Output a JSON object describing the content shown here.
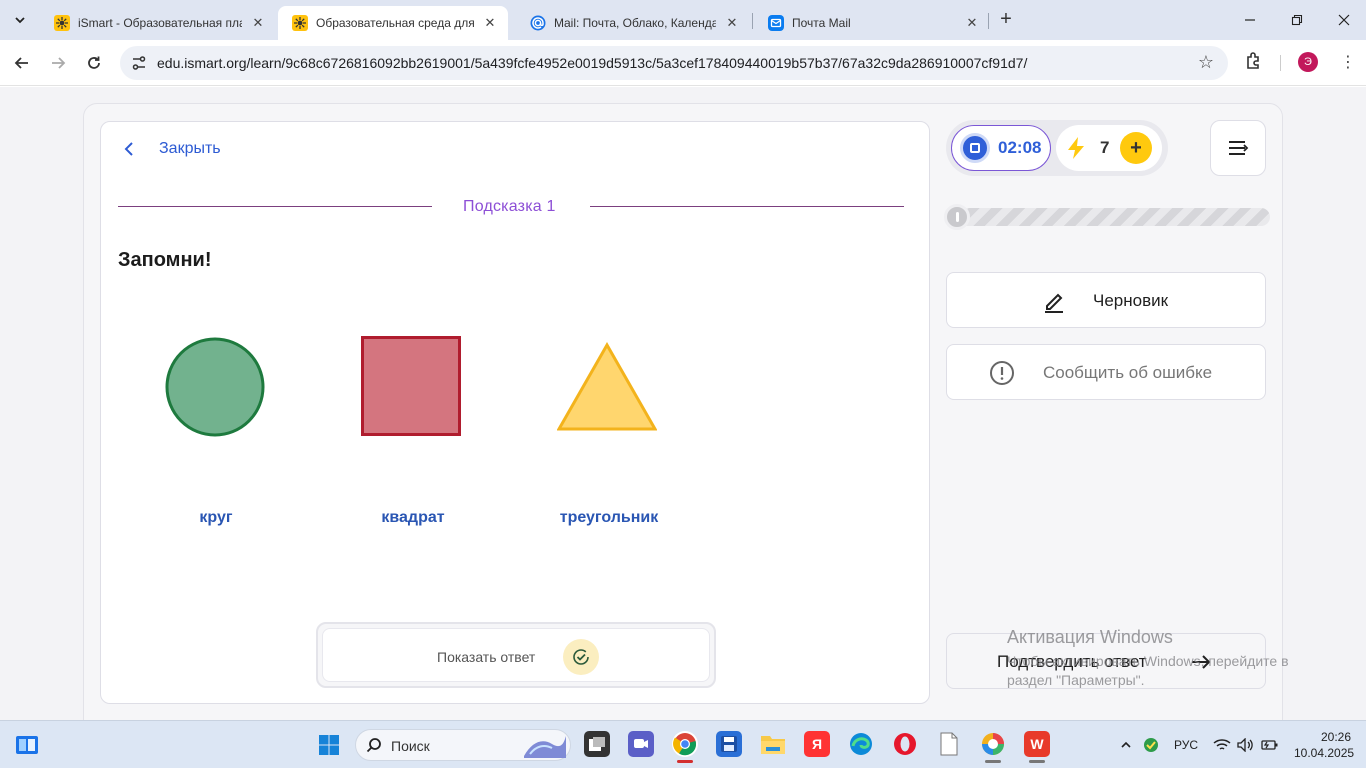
{
  "browser": {
    "tabs": [
      {
        "title": "iSmart - Образовательная плат",
        "icon": "ismart-favicon",
        "active": false
      },
      {
        "title": "Образовательная среда для са",
        "icon": "ismart-favicon",
        "active": true
      },
      {
        "title": "Mail: Почта, Облако, Календар",
        "icon": "mail-at-favicon",
        "active": false
      },
      {
        "title": "Почта Mail",
        "icon": "mail-envelope-favicon",
        "active": false
      }
    ],
    "url": "edu.ismart.org/learn/9c68c6726816092bb2619001/5a439fcfe4952e0019d5913c/5a3cef178409440019b57b37/67a32c9da286910007cf91d7/",
    "profile_initial": "Э"
  },
  "task": {
    "close_label": "Закрыть",
    "hint_title": "Подсказка 1",
    "heading": "Запомни!",
    "shapes": [
      {
        "label": "круг",
        "kind": "circle",
        "fill": "#72b28e",
        "stroke": "#1e7a3e"
      },
      {
        "label": "квадрат",
        "kind": "square",
        "fill": "#d4757f",
        "stroke": "#b01c2e"
      },
      {
        "label": "треугольник",
        "kind": "triangle",
        "fill": "#ffd66e",
        "stroke": "#f3b31c"
      }
    ],
    "show_answer_label": "Показать ответ"
  },
  "sidebar": {
    "timer": "02:08",
    "energy": "7",
    "progress": 0,
    "draft_label": "Черновик",
    "report_label": "Сообщить об ошибке",
    "confirm_label": "Подтвердить ответ"
  },
  "watermark": {
    "title": "Активация Windows",
    "subtitle": "Чтобы активировать Windows, перейдите в раздел \"Параметры\"."
  },
  "taskbar": {
    "search_label": "Поиск",
    "language": "РУС",
    "time": "20:26",
    "date": "10.04.2025"
  },
  "colors": {
    "accent_blue": "#2d5bd3",
    "hint_purple": "#8d4fd6",
    "energy_yellow": "#ffc90e"
  }
}
